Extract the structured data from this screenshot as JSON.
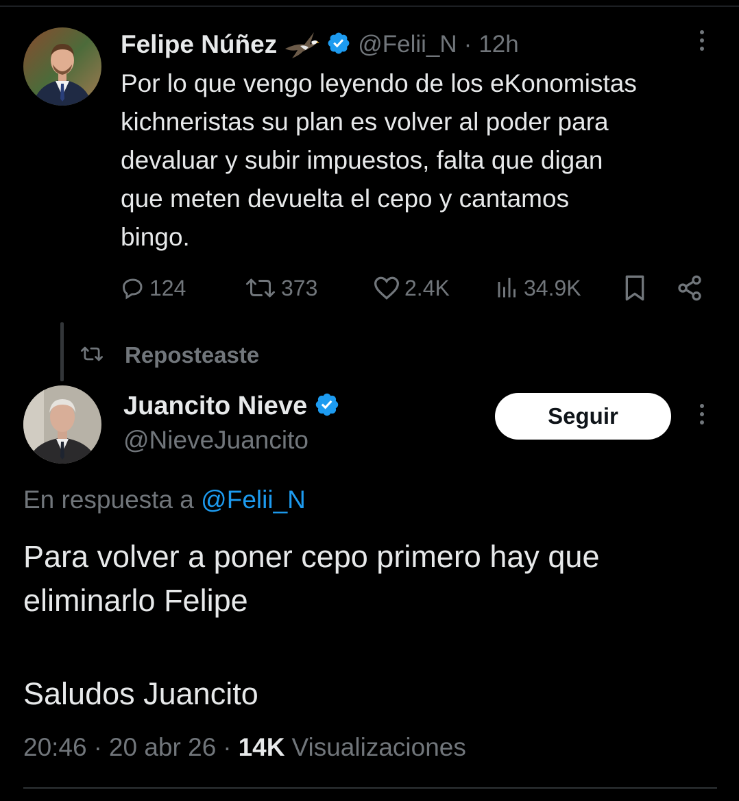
{
  "original_tweet": {
    "display_name": "Felipe Núñez",
    "handle": "@Felii_N",
    "separator": "·",
    "time": "12h",
    "text_lines": [
      "Por lo que vengo leyendo de los eKonomistas",
      "kichneristas su plan es volver al poder para",
      "devaluar y subir impuestos, falta que digan",
      "que meten devuelta el cepo y cantamos",
      "bingo."
    ],
    "actions": {
      "replies": "124",
      "reposts": "373",
      "likes": "2.4K",
      "views": "34.9K"
    },
    "icons": [
      "eagle-emoji-icon",
      "verified-badge-icon",
      "more-options-icon",
      "reply-icon",
      "repost-icon",
      "like-icon",
      "views-icon",
      "bookmark-icon",
      "share-icon"
    ]
  },
  "repost_indicator": {
    "label": "Reposteaste"
  },
  "reply_tweet": {
    "display_name": "Juancito Nieve",
    "handle": "@NieveJuancito",
    "follow_label": "Seguir",
    "in_reply_prefix": "En respuesta a",
    "in_reply_handle": "@Felii_N",
    "text_lines": [
      "Para volver a poner cepo primero hay que",
      "eliminarlo Felipe"
    ],
    "signoff": "Saludos Juancito",
    "time": "20:46",
    "separator": "·",
    "date": "20 abr 26",
    "views_count": "14K",
    "views_label": "Visualizaciones"
  },
  "colors": {
    "background": "#000000",
    "text": "#e7e9ea",
    "muted": "#71767b",
    "accent": "#1d9bf0",
    "button_bg": "#ffffff"
  }
}
